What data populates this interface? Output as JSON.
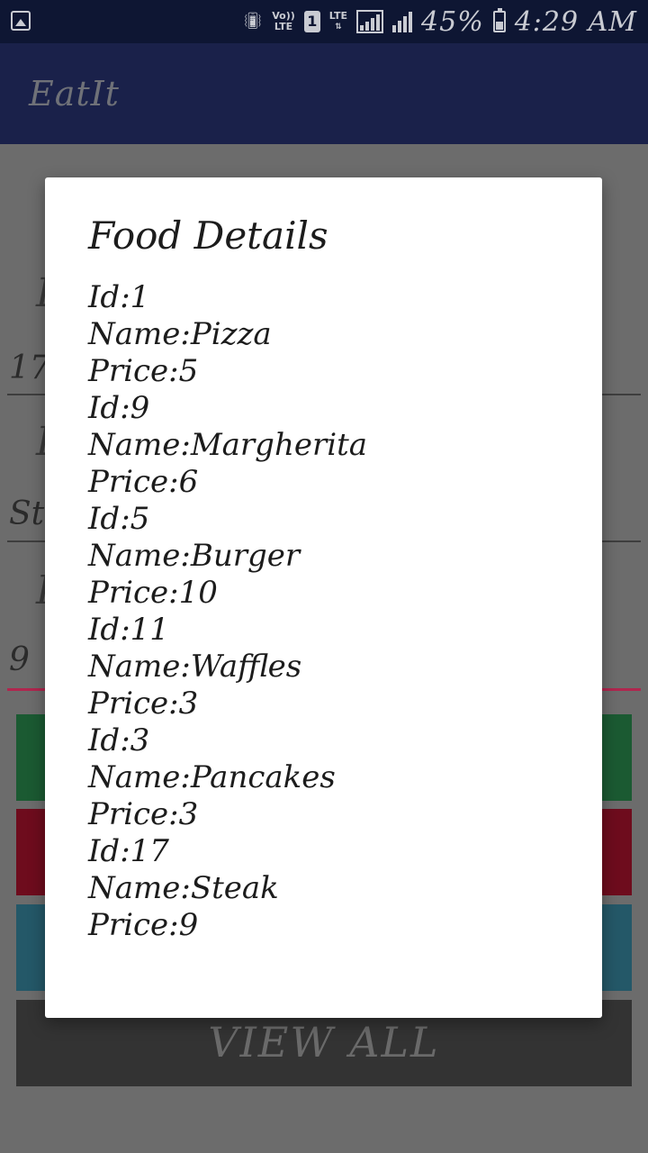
{
  "status_bar": {
    "left_icon": "gallery-icon",
    "network_label_top": "Vo))",
    "network_label_bottom": "LTE",
    "sim_slot": "1",
    "data_type": "LTE",
    "battery": "45%",
    "time": "4:29 AM"
  },
  "app_bar": {
    "title": "EatIt"
  },
  "background_form": {
    "field1_value": "17",
    "field2_value": "Ste",
    "field3_value": "9",
    "view_all_label": "VIEW ALL"
  },
  "dialog": {
    "title": "Food Details",
    "lines": [
      "Id:1",
      "Name:Pizza",
      "Price:5",
      "Id:9",
      "Name:Margherita",
      "Price:6",
      "Id:5",
      "Name:Burger",
      "Price:10",
      "Id:11",
      "Name:Waffles",
      "Price:3",
      "Id:3",
      "Name:Pancakes",
      "Price:3",
      "Id:17",
      "Name:Steak",
      "Price:9"
    ]
  }
}
